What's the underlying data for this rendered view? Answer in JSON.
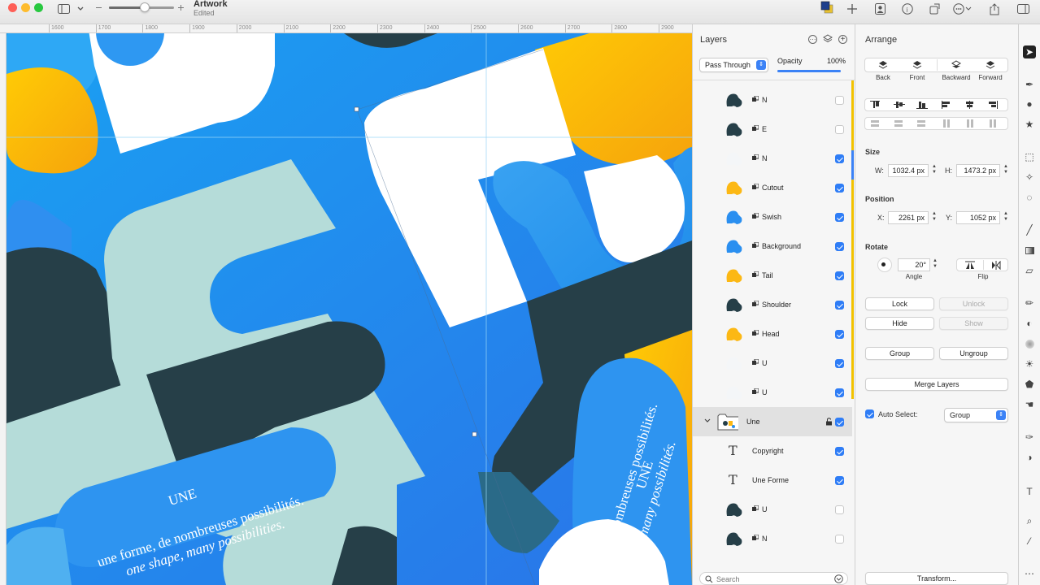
{
  "toolbar": {
    "title": "Artwork",
    "status": "Edited",
    "zoom_fraction": 0.55,
    "icons": [
      "sidebar-icon",
      "chevron-down-icon",
      "zoom-out-icon",
      "zoom-in-icon",
      "color-icon",
      "plus-icon",
      "portrait-icon",
      "info-icon",
      "rotate-icon",
      "more-icon",
      "share-icon",
      "window-icon"
    ]
  },
  "rulers": {
    "top": [
      "1600",
      "1700",
      "1800",
      "1900",
      "2000",
      "2100",
      "2200",
      "2300",
      "2400",
      "2500",
      "2600",
      "2700",
      "2800",
      "2900"
    ]
  },
  "artwork": {
    "left_text": [
      "UNE",
      "une forme, de nombreuses possibilités.",
      "one shape, many possibilities."
    ],
    "right_text": [
      "UNE",
      "forme, de nombreuses possibilités.",
      "shape, many possibilités."
    ],
    "colors": {
      "blue": "#2794f0",
      "dark": "#263f48",
      "mint": "#b5dcd9",
      "yellow": "#fcb814",
      "white": "#ffffff"
    }
  },
  "layers": {
    "title": "Layers",
    "blend_mode": "Pass Through",
    "opacity_label": "Opacity",
    "opacity_value": "100%",
    "opacity_fraction": 1.0,
    "rows": [
      {
        "name": "N",
        "visible": false,
        "thumb": "dark"
      },
      {
        "name": "E",
        "visible": false,
        "thumb": "dark"
      },
      {
        "name": "N",
        "visible": true,
        "thumb": "white"
      },
      {
        "name": "Cutout",
        "visible": true,
        "thumb": "yellow"
      },
      {
        "name": "Swish",
        "visible": true,
        "thumb": "blue"
      },
      {
        "name": "Background",
        "visible": true,
        "thumb": "blue"
      },
      {
        "name": "Tail",
        "visible": true,
        "thumb": "yellow"
      },
      {
        "name": "Shoulder",
        "visible": true,
        "thumb": "dark"
      },
      {
        "name": "Head",
        "visible": true,
        "thumb": "yellow"
      },
      {
        "name": "U",
        "visible": true,
        "thumb": "white"
      },
      {
        "name": "U",
        "visible": true,
        "thumb": "white"
      },
      {
        "name": "Une",
        "visible": true,
        "thumb": "group"
      },
      {
        "name": "Copyright",
        "visible": true,
        "thumb": "text"
      },
      {
        "name": "Une Forme",
        "visible": true,
        "thumb": "text"
      },
      {
        "name": "U",
        "visible": false,
        "thumb": "dark"
      },
      {
        "name": "N",
        "visible": false,
        "thumb": "dark"
      }
    ],
    "search_placeholder": "Search"
  },
  "arrange": {
    "title": "Arrange",
    "order_buttons": [
      "Back",
      "Front",
      "Backward",
      "Forward"
    ],
    "size_label": "Size",
    "width_label": "W:",
    "width": "1032.4 px",
    "height_label": "H:",
    "height": "1473.2 px",
    "position_label": "Position",
    "x_label": "X:",
    "x": "2261 px",
    "y_label": "Y:",
    "y": "1052 px",
    "rotate_label": "Rotate",
    "angle": "20°",
    "angle_label": "Angle",
    "flip_label": "Flip",
    "lock": "Lock",
    "unlock": "Unlock",
    "hide": "Hide",
    "show": "Show",
    "group": "Group",
    "ungroup": "Ungroup",
    "merge": "Merge Layers",
    "auto_select_label": "Auto Select:",
    "auto_select_value": "Group",
    "transform": "Transform..."
  },
  "tools": [
    "arrow-icon",
    "pen-nib-icon",
    "shapes-icon",
    "star-icon",
    "marquee-icon",
    "magic-wand-icon",
    "lasso-icon",
    "brush-icon",
    "gradient-icon",
    "eraser-icon",
    "pencil-icon",
    "fill-icon",
    "blur-icon",
    "sun-icon",
    "clone-icon",
    "smudge-icon",
    "pen-icon",
    "shape-icon",
    "text-icon",
    "zoom-icon",
    "eyedropper-icon",
    "more-icon"
  ]
}
